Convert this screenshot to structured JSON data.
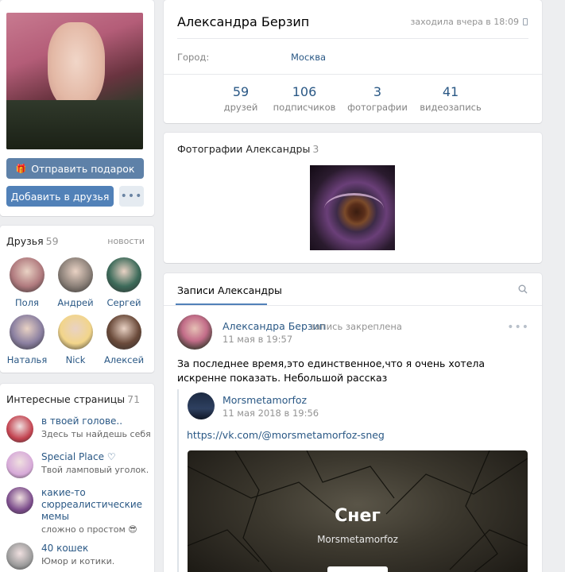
{
  "profile": {
    "name": "Александра Берзип",
    "online": "заходила вчера в 18:09",
    "city_label": "Город:",
    "city_value": "Москва",
    "gift_button": "Отправить подарок",
    "add_friend_button": "Добавить в друзья",
    "more_button": "•••",
    "stats": [
      {
        "value": "59",
        "label": "друзей"
      },
      {
        "value": "106",
        "label": "подписчиков"
      },
      {
        "value": "3",
        "label": "фотографии"
      },
      {
        "value": "41",
        "label": "видеозапись"
      }
    ]
  },
  "friends": {
    "title": "Друзья",
    "count": "59",
    "link": "новости",
    "items": [
      {
        "name": "Поля",
        "color": "#b07a7e"
      },
      {
        "name": "Андрей",
        "color": "#8b8078"
      },
      {
        "name": "Сергей",
        "color": "#3d6b5a"
      },
      {
        "name": "Наталья",
        "color": "#8a7fa0"
      },
      {
        "name": "Nick",
        "color": "#f2d58a"
      },
      {
        "name": "Алексей",
        "color": "#6a4a3a"
      }
    ]
  },
  "pages": {
    "title": "Интересные страницы",
    "count": "71",
    "items": [
      {
        "title": "в твоей голове..",
        "subtitle": "Здесь ты найдешь себя",
        "color": "#c2424f"
      },
      {
        "title": "Special Place ♡",
        "subtitle": "Твой ламповый уголок.",
        "color": "#d6a9d8"
      },
      {
        "title": "какие-то сюрреалистические мемы",
        "subtitle": "сложно о простом 😎",
        "color": "#7a4b8a"
      },
      {
        "title": "40 кошек",
        "subtitle": "Юмор и котики.",
        "color": "#9a9a9a"
      }
    ]
  },
  "photos": {
    "title": "Фотографии Александры",
    "count": "3"
  },
  "wall": {
    "tab": "Записи Александры",
    "post": {
      "author": "Александра Берзип",
      "pinned": "запись закреплена",
      "date": "11 мая в 19:57",
      "more": "•••",
      "text": "За последнее время,это единственное,что я очень хотела искренне показать. Небольшой рассказ"
    },
    "repost": {
      "author": "Morsmetamorfoz",
      "date": "11 мая 2018 в 19:56",
      "link": "https://vk.com/@morsmetamorfoz-sneg",
      "article_title": "Снег",
      "article_author": "Morsmetamorfoz"
    }
  },
  "icons": {
    "gift": "gift-icon",
    "phone": "phone-icon",
    "search": "search-icon"
  },
  "colors": {
    "accent": "#5181b8",
    "link": "#2a5885",
    "background": "#edeef0"
  }
}
